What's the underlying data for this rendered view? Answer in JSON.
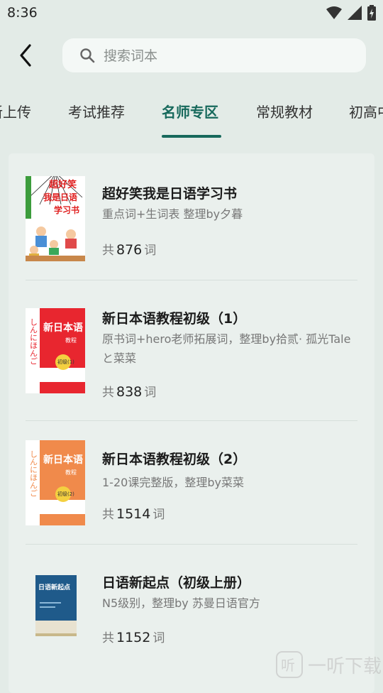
{
  "status_bar": {
    "time": "8:36"
  },
  "search": {
    "placeholder": "搜索词本"
  },
  "tabs": [
    {
      "label": "新上传"
    },
    {
      "label": "考试推荐"
    },
    {
      "label": "名师专区",
      "active": true
    },
    {
      "label": "常规教材"
    },
    {
      "label": "初高中"
    }
  ],
  "books": [
    {
      "title": "超好笑我是日语学习书",
      "description": "重点词+生词表 整理by夕暮",
      "count_prefix": "共",
      "count": "876",
      "count_suffix": "词",
      "cover": {
        "text_line1": "超好笑",
        "text_line2": "我是日语",
        "text_line3": "学习书"
      }
    },
    {
      "title": "新日本语教程初级（1）",
      "description": "原书词+hero老师拓展词，整理by拾贰· 孤光Taleと菜菜",
      "count_prefix": "共",
      "count": "838",
      "count_suffix": "词",
      "cover": {
        "main": "新日本语",
        "sub": "教程",
        "kana": "しんにほんご",
        "badge": "初级(1)",
        "color": "#e8262f"
      }
    },
    {
      "title": "新日本语教程初级（2）",
      "description": "1-20课完整版，整理by菜菜",
      "count_prefix": "共",
      "count": "1514",
      "count_suffix": "词",
      "cover": {
        "main": "新日本语",
        "sub": "教程",
        "kana": "しんにほんご",
        "badge": "初级(2)",
        "color": "#f08a4b"
      }
    },
    {
      "title": "日语新起点（初级上册）",
      "description": "N5级别，整理by 苏曼日语官方",
      "count_prefix": "共",
      "count": "1152",
      "count_suffix": "词",
      "cover": {
        "main": "日语新起点",
        "color": "#1f5a8a"
      }
    }
  ],
  "watermark": {
    "text": "一听下载"
  },
  "colors": {
    "accent": "#17695c",
    "background": "#e3ebe7",
    "panel": "#eaf0ed"
  }
}
